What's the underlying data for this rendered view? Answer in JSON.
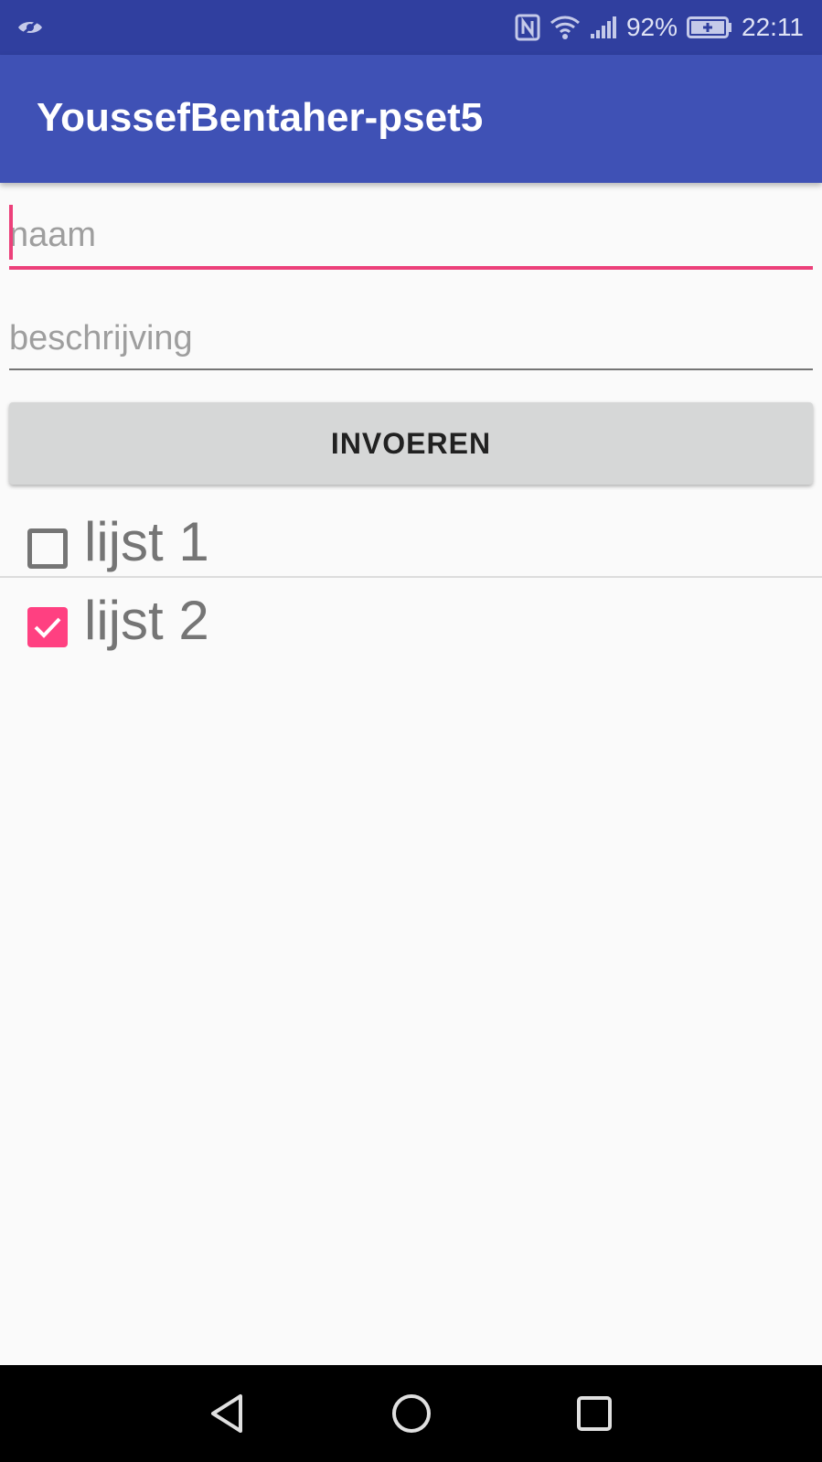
{
  "status_bar": {
    "icons": [
      "eye-off-icon",
      "nfc-icon",
      "wifi-icon",
      "signal-icon",
      "battery-charging-icon"
    ],
    "battery_percent": "92%",
    "time": "22:11"
  },
  "app_bar": {
    "title": "YoussefBentaher-pset5"
  },
  "form": {
    "name_field": {
      "placeholder": "naam",
      "value": "",
      "focused": true
    },
    "description_field": {
      "placeholder": "beschrijving",
      "value": ""
    },
    "submit_label": "INVOEREN"
  },
  "lists": [
    {
      "label": "lijst 1",
      "checked": false
    },
    {
      "label": "lijst 2",
      "checked": true
    }
  ],
  "nav_bar": {
    "buttons": [
      "back-icon",
      "home-icon",
      "recents-icon"
    ]
  },
  "colors": {
    "status_bar": "#303f9f",
    "app_bar": "#3f51b5",
    "accent": "#ff4081",
    "button": "#d6d7d7",
    "background": "#fafafa"
  }
}
